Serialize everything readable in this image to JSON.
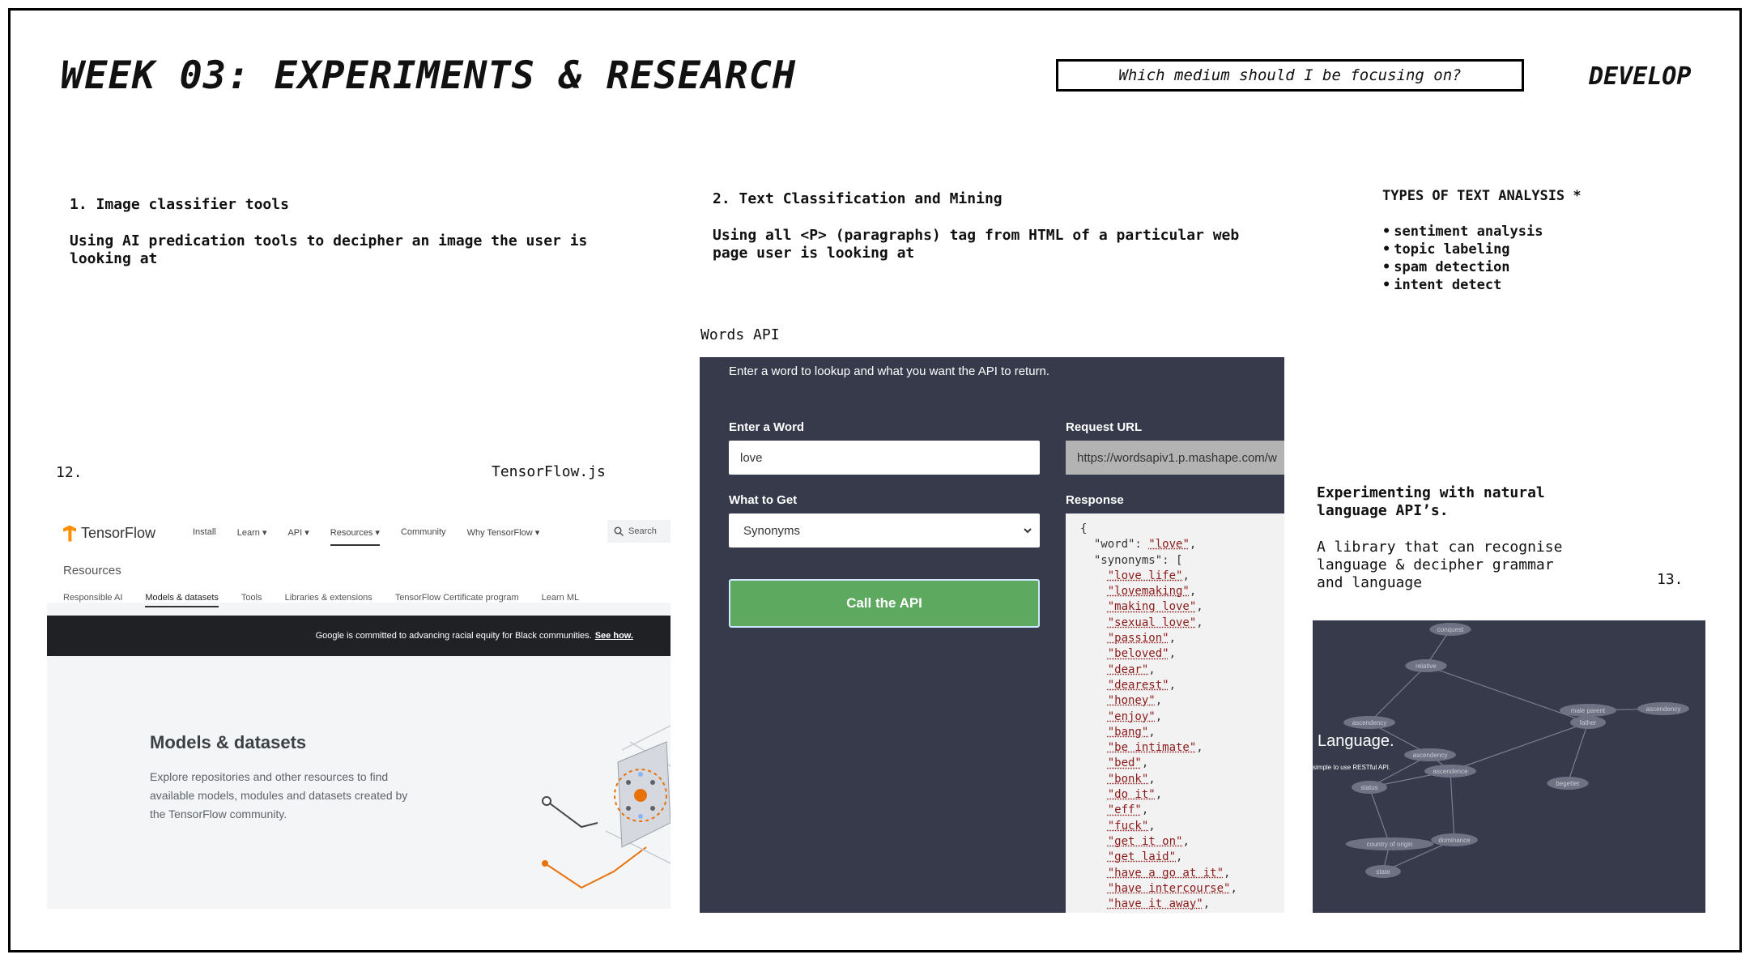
{
  "header": {
    "title": "WEEK 03: EXPERIMENTS & RESEARCH",
    "question": "Which medium should I be focusing on?",
    "stage": "DEVELOP"
  },
  "section1": {
    "number": "1.",
    "heading": "Image classifier tools",
    "body": "Using AI predication tools to decipher an image the user is looking at"
  },
  "section2": {
    "heading": "2. Text Classification and Mining",
    "body": "Using all <P> (paragraphs) tag from HTML of a particular web page user is looking at"
  },
  "types": {
    "heading": "TYPES OF TEXT ANALYSIS *",
    "items": [
      "sentiment analysis",
      "topic labeling",
      "spam detection",
      "intent detect"
    ]
  },
  "labels": {
    "num12": "12.",
    "tensorflow_js": "TensorFlow.js",
    "words_api": "Words API",
    "num13": "13."
  },
  "nlp": {
    "heading": "Experimenting with natural language API’s.",
    "body": "A library that can recognise language & decipher grammar and language"
  },
  "tensorflow_shot": {
    "logo": "TensorFlow",
    "nav": [
      "Install",
      "Learn ▾",
      "API ▾",
      "Resources ▾",
      "Community",
      "Why TensorFlow ▾"
    ],
    "search": "Search",
    "resources": "Resources",
    "subnav": [
      "Responsible AI",
      "Models & datasets",
      "Tools",
      "Libraries & extensions",
      "TensorFlow Certificate program",
      "Learn ML"
    ],
    "banner": "Google is committed to advancing racial equity for Black communities.",
    "banner_link": "See how.",
    "hero_title": "Models & datasets",
    "hero_desc": "Explore repositories and other resources to find available models, modules and datasets created by the TensorFlow community."
  },
  "words_api_shot": {
    "intro": "Enter a word to lookup and what you want the API to return.",
    "word_label": "Enter a Word",
    "word_value": "love",
    "url_label": "Request URL",
    "url_value": "https://wordsapiv1.p.mashape.com/w",
    "get_label": "What to Get",
    "get_value": "Synonyms",
    "call_button": "Call the API",
    "response_label": "Response",
    "response_word": "love",
    "synonyms": [
      "love life",
      "lovemaking",
      "making love",
      "sexual love",
      "passion",
      "beloved",
      "dear",
      "dearest",
      "honey",
      "enjoy",
      "bang",
      "be intimate",
      "bed",
      "bonk",
      "do it",
      "eff",
      "fuck",
      "get it on",
      "get laid",
      "have a go at it",
      "have intercourse",
      "have it away"
    ]
  },
  "graph_shot": {
    "title": "Language.",
    "subtitle": "simple to use RESTful API.",
    "nodes": [
      "conquest",
      "relative",
      "ascendency",
      "ascendency",
      "father",
      "male parent",
      "ascendency",
      "ascendence",
      "begetter",
      "status",
      "country of origin",
      "dominance",
      "state"
    ]
  }
}
